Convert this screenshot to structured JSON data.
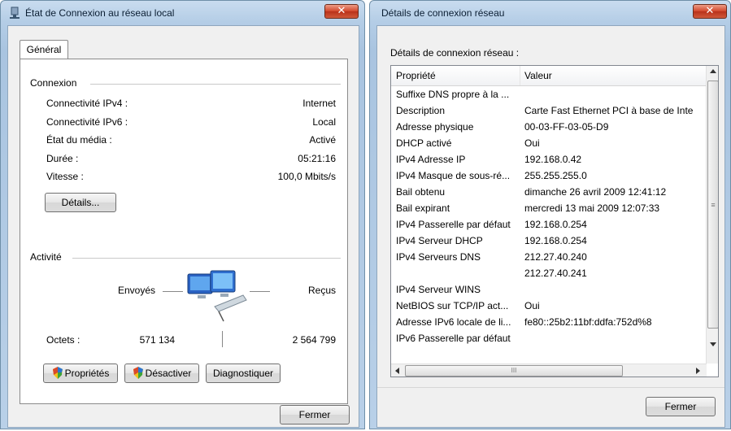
{
  "left": {
    "title": "État de Connexion au réseau local",
    "tab": "Général",
    "connexion_label": "Connexion",
    "rows": [
      {
        "label": "Connectivité IPv4 :",
        "value": "Internet"
      },
      {
        "label": "Connectivité IPv6 :",
        "value": "Local"
      },
      {
        "label": "État du média :",
        "value": "Activé"
      },
      {
        "label": "Durée :",
        "value": "05:21:16"
      },
      {
        "label": "Vitesse :",
        "value": "100,0 Mbits/s"
      }
    ],
    "details_button": "Détails...",
    "activite_label": "Activité",
    "envoyes": "Envoyés",
    "recus": "Reçus",
    "octets_label": "Octets :",
    "octets_sent": "571 134",
    "octets_received": "2 564 799",
    "btn_proprietes": "Propriétés",
    "btn_desactiver": "Désactiver",
    "btn_diagnostiquer": "Diagnostiquer",
    "btn_fermer": "Fermer"
  },
  "right": {
    "title": "Détails de connexion réseau",
    "subtitle": "Détails de connexion réseau :",
    "col_prop": "Propriété",
    "col_val": "Valeur",
    "rows": [
      {
        "p": "Suffixe DNS propre à la ...",
        "v": ""
      },
      {
        "p": "Description",
        "v": "Carte Fast Ethernet PCI à base de Inte"
      },
      {
        "p": "Adresse physique",
        "v": "00-03-FF-03-05-D9"
      },
      {
        "p": "DHCP activé",
        "v": "Oui"
      },
      {
        "p": "IPv4 Adresse IP",
        "v": "192.168.0.42"
      },
      {
        "p": "IPv4 Masque de sous-ré...",
        "v": "255.255.255.0"
      },
      {
        "p": "Bail obtenu",
        "v": "dimanche 26 avril 2009 12:41:12"
      },
      {
        "p": "Bail expirant",
        "v": "mercredi 13 mai 2009 12:07:33"
      },
      {
        "p": "IPv4 Passerelle par défaut",
        "v": "192.168.0.254"
      },
      {
        "p": "IPv4 Serveur DHCP",
        "v": "192.168.0.254"
      },
      {
        "p": "IPv4 Serveurs DNS",
        "v": "212.27.40.240"
      },
      {
        "p": "",
        "v": "212.27.40.241"
      },
      {
        "p": "IPv4 Serveur WINS",
        "v": ""
      },
      {
        "p": "NetBIOS sur TCP/IP act...",
        "v": "Oui"
      },
      {
        "p": "Adresse IPv6 locale de li...",
        "v": "fe80::25b2:11bf:ddfa:752d%8"
      },
      {
        "p": "IPv6 Passerelle par défaut",
        "v": ""
      }
    ],
    "btn_fermer": "Fermer",
    "close_glyph": "✕",
    "scroll_h_glyph": "III",
    "scroll_v_glyph": "≡"
  },
  "icons": {
    "left_title_icon": "network-icon",
    "left_close": "close-icon",
    "right_close": "close-icon",
    "shield": "uac-shield-icon",
    "network_activity": "network-activity-icon"
  }
}
